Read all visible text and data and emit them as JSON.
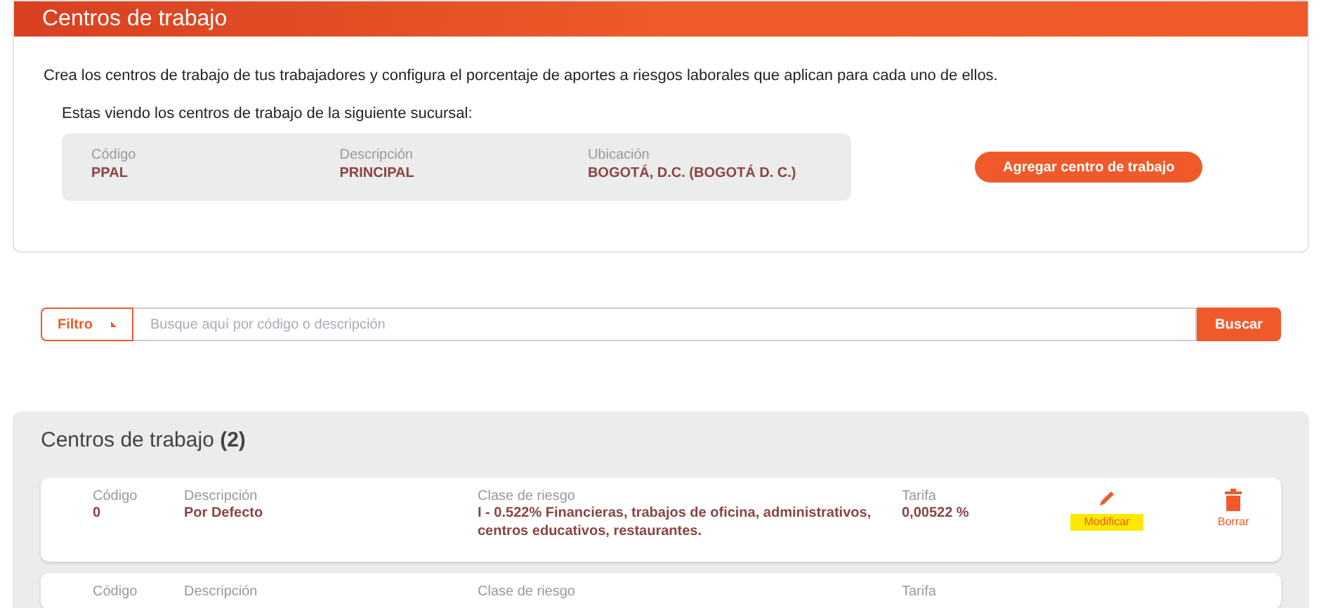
{
  "header": {
    "title": "Centros de trabajo"
  },
  "intro": {
    "description": "Crea los centros de trabajo de tus trabajadores y configura el porcentaje de aportes a riesgos laborales que aplican para cada uno de ellos.",
    "branch_caption": "Estas viendo los centros de trabajo de la siguiente sucursal:",
    "branch_fields": [
      {
        "label": "Código",
        "value": "PPAL"
      },
      {
        "label": "Descripción",
        "value": "PRINCIPAL"
      },
      {
        "label": "Ubicación",
        "value": "BOGOTÁ, D.C. (BOGOTÁ D. C.)"
      }
    ],
    "add_button": "Agregar centro de trabajo"
  },
  "search": {
    "filter_label": "Filtro",
    "placeholder": "Busque aquí por código o descripción",
    "button": "Buscar"
  },
  "list": {
    "title": "Centros de trabajo",
    "count": "(2)",
    "rows": [
      {
        "fields": [
          {
            "label": "Código",
            "value": "0"
          },
          {
            "label": "Descripción",
            "value": "Por Defecto"
          },
          {
            "label": "Clase de riesgo",
            "value": "I - 0.522% Financieras, trabajos de oficina, administrativos, centros educativos, restaurantes."
          },
          {
            "label": "Tarifa",
            "value": "0,00522 %"
          }
        ],
        "actions": [
          {
            "kind": "edit",
            "label": "Modificar",
            "highlighted": true
          },
          {
            "kind": "delete",
            "label": "Borrar",
            "highlighted": false
          }
        ]
      },
      {
        "fields": [
          {
            "label": "Código"
          },
          {
            "label": "Descripción"
          },
          {
            "label": "Clase de riesgo"
          },
          {
            "label": "Tarifa"
          }
        ]
      }
    ]
  }
}
